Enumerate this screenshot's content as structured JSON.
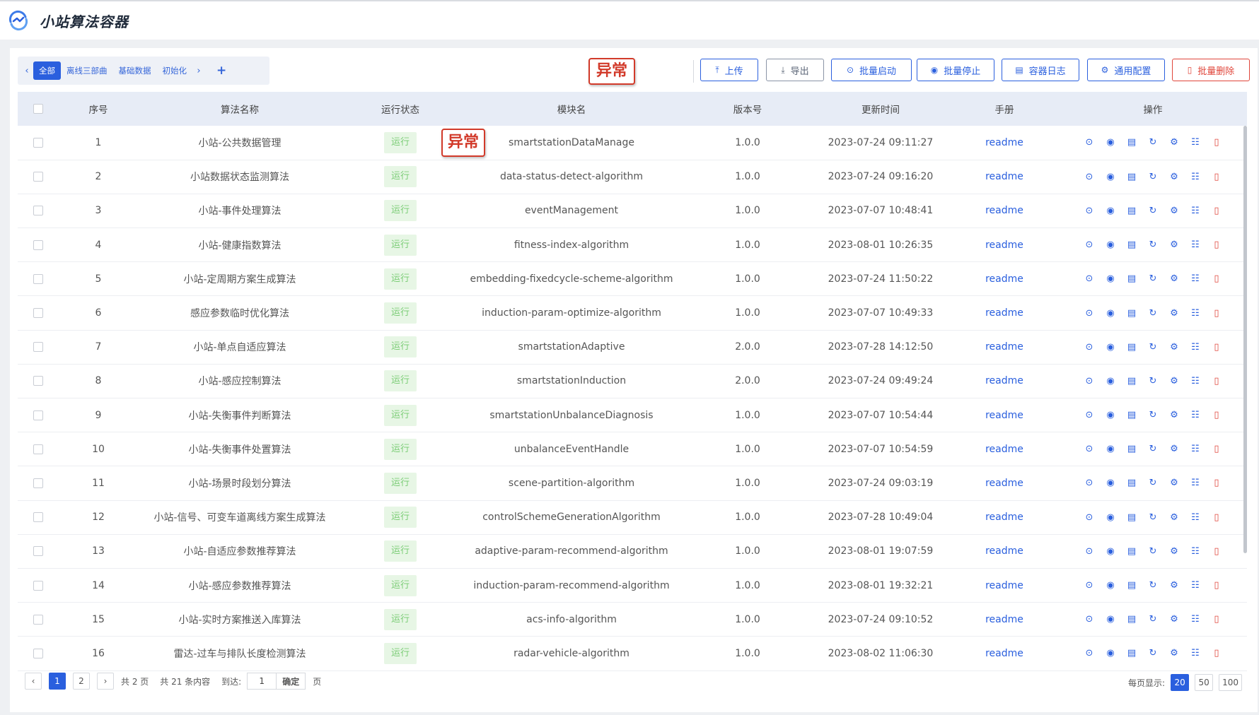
{
  "app": {
    "title": "小站算法容器",
    "logo_icon": "app-logo-icon"
  },
  "tabs": {
    "items": [
      "全部",
      "离线三部曲",
      "基础数据",
      "初始化"
    ],
    "active": 0,
    "prev_icon": "chevron-left-icon",
    "next_icon": "chevron-right-icon",
    "add_label": "+"
  },
  "annotations": {
    "anomaly": "异常"
  },
  "toolbar": {
    "upload": "上传",
    "export": "导出",
    "batch_start": "批量启动",
    "batch_stop": "批量停止",
    "container_log": "容器日志",
    "general_config": "通用配置",
    "batch_delete": "批量删除"
  },
  "table": {
    "headers": {
      "index": "序号",
      "name": "算法名称",
      "status": "运行状态",
      "module": "模块名",
      "version": "版本号",
      "updated": "更新时间",
      "manual": "手册",
      "ops": "操作"
    },
    "rows": [
      {
        "index": "1",
        "name": "小站-公共数据管理",
        "status": "运行",
        "module": "smartstationDataManage",
        "version": "1.0.0",
        "updated": "2023-07-24 09:11:27",
        "manual": "readme"
      },
      {
        "index": "2",
        "name": "小站数据状态监测算法",
        "status": "运行",
        "module": "data-status-detect-algorithm",
        "version": "1.0.0",
        "updated": "2023-07-24 09:16:20",
        "manual": "readme"
      },
      {
        "index": "3",
        "name": "小站-事件处理算法",
        "status": "运行",
        "module": "eventManagement",
        "version": "1.0.0",
        "updated": "2023-07-07 10:48:41",
        "manual": "readme"
      },
      {
        "index": "4",
        "name": "小站-健康指数算法",
        "status": "运行",
        "module": "fitness-index-algorithm",
        "version": "1.0.0",
        "updated": "2023-08-01 10:26:35",
        "manual": "readme"
      },
      {
        "index": "5",
        "name": "小站-定周期方案生成算法",
        "status": "运行",
        "module": "embedding-fixedcycle-scheme-algorithm",
        "version": "1.0.0",
        "updated": "2023-07-24 11:50:22",
        "manual": "readme"
      },
      {
        "index": "6",
        "name": "感应参数临时优化算法",
        "status": "运行",
        "module": "induction-param-optimize-algorithm",
        "version": "1.0.0",
        "updated": "2023-07-07 10:49:33",
        "manual": "readme"
      },
      {
        "index": "7",
        "name": "小站-单点自适应算法",
        "status": "运行",
        "module": "smartstationAdaptive",
        "version": "2.0.0",
        "updated": "2023-07-28 14:12:50",
        "manual": "readme"
      },
      {
        "index": "8",
        "name": "小站-感应控制算法",
        "status": "运行",
        "module": "smartstationInduction",
        "version": "2.0.0",
        "updated": "2023-07-24 09:49:24",
        "manual": "readme"
      },
      {
        "index": "9",
        "name": "小站-失衡事件判断算法",
        "status": "运行",
        "module": "smartstationUnbalanceDiagnosis",
        "version": "1.0.0",
        "updated": "2023-07-07 10:54:44",
        "manual": "readme"
      },
      {
        "index": "10",
        "name": "小站-失衡事件处置算法",
        "status": "运行",
        "module": "unbalanceEventHandle",
        "version": "1.0.0",
        "updated": "2023-07-07 10:54:59",
        "manual": "readme"
      },
      {
        "index": "11",
        "name": "小站-场景时段划分算法",
        "status": "运行",
        "module": "scene-partition-algorithm",
        "version": "1.0.0",
        "updated": "2023-07-24 09:03:19",
        "manual": "readme"
      },
      {
        "index": "12",
        "name": "小站-信号、可变车道离线方案生成算法",
        "status": "运行",
        "module": "controlSchemeGenerationAlgorithm",
        "version": "1.0.0",
        "updated": "2023-07-28 10:49:04",
        "manual": "readme"
      },
      {
        "index": "13",
        "name": "小站-自适应参数推荐算法",
        "status": "运行",
        "module": "adaptive-param-recommend-algorithm",
        "version": "1.0.0",
        "updated": "2023-08-01 19:07:59",
        "manual": "readme"
      },
      {
        "index": "14",
        "name": "小站-感应参数推荐算法",
        "status": "运行",
        "module": "induction-param-recommend-algorithm",
        "version": "1.0.0",
        "updated": "2023-08-01 19:32:21",
        "manual": "readme"
      },
      {
        "index": "15",
        "name": "小站-实时方案推送入库算法",
        "status": "运行",
        "module": "acs-info-algorithm",
        "version": "1.0.0",
        "updated": "2023-07-24 09:10:52",
        "manual": "readme"
      },
      {
        "index": "16",
        "name": "雷达-过车与排队长度检测算法",
        "status": "运行",
        "module": "radar-vehicle-algorithm",
        "version": "1.0.0",
        "updated": "2023-08-02 11:06:30",
        "manual": "readme"
      }
    ]
  },
  "row_ops": [
    "play-icon",
    "stop-icon",
    "log-icon",
    "restart-icon",
    "config-icon",
    "deploy-icon",
    "delete-icon"
  ],
  "pagination": {
    "pages": [
      "1",
      "2"
    ],
    "current": "1",
    "total_pages": "共 2 页",
    "total_items": "共 21 条内容",
    "goto_label": "到达:",
    "goto_value": "1",
    "confirm": "确定",
    "page_suffix": "页",
    "page_size_label": "每页显示:",
    "page_sizes": [
      "20",
      "50",
      "100"
    ],
    "page_size_selected": "20"
  },
  "colors": {
    "primary": "#2a5fde",
    "danger": "#e0453a",
    "running_bg": "#e7f6e5",
    "running_text": "#7ccd77",
    "anomaly": "#d23a2a"
  }
}
